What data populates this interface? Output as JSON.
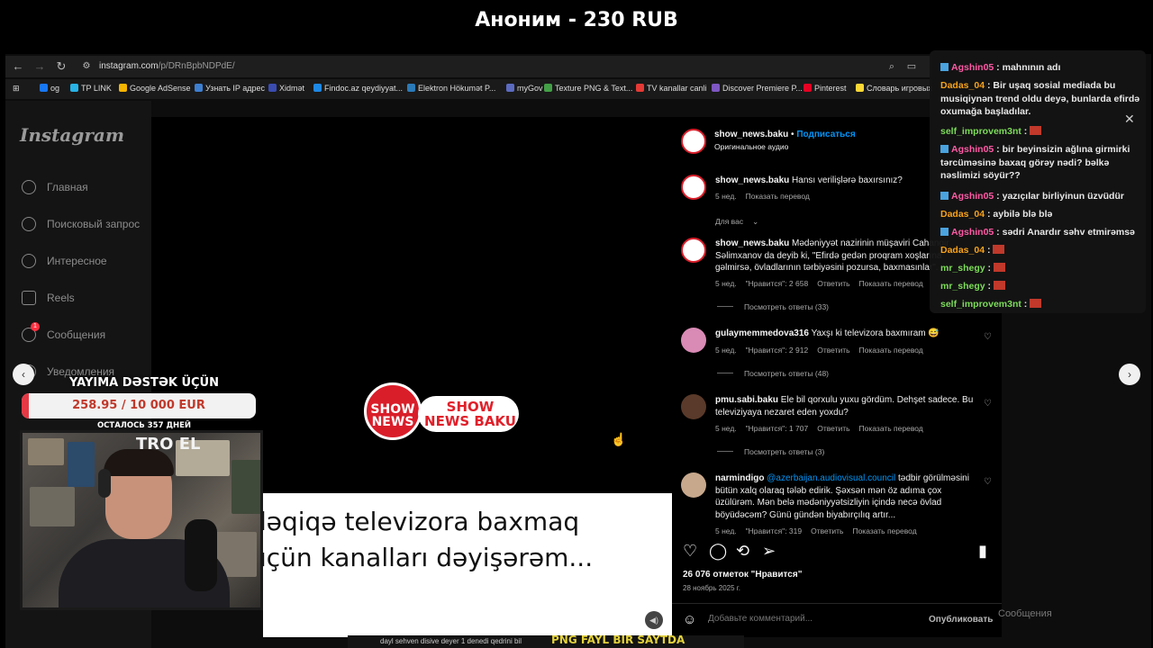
{
  "stream": {
    "donor_banner": "Аноним - 230 RUB",
    "donate": {
      "title": "YAYIMA DƏSTƏK ÜÇÜN",
      "amount": "258.95 / 10 000 EUR",
      "progress_fraction": 0.0259,
      "days_left": "ОСТАЛОСЬ 357 ДНЕЙ"
    },
    "webcam_poster": "TRO EL"
  },
  "browser": {
    "url_domain": "instagram.com",
    "url_path": "/p/DRnBpbNDPdE/",
    "bookmarks": [
      {
        "label": "og",
        "color": "#1877f2"
      },
      {
        "label": "TP LINK",
        "color": "#27b3e6"
      },
      {
        "label": "Google AdSense",
        "color": "#f4b400"
      },
      {
        "label": "Узнать IP адрес",
        "color": "#3d7fd1"
      },
      {
        "label": "Xidmət",
        "color": "#3a4cb0"
      },
      {
        "label": "Findoc.az qeydiyyat...",
        "color": "#1e88e5"
      },
      {
        "label": "Elektron Hökumət P...",
        "color": "#2a7ab8"
      },
      {
        "label": "myGov",
        "color": "#5c6bc0"
      },
      {
        "label": "Texture PNG & Text...",
        "color": "#43a047"
      },
      {
        "label": "TV kanallar canli",
        "color": "#e53935"
      },
      {
        "label": "Discover Premiere P...",
        "color": "#7e57c2"
      },
      {
        "label": "Pinterest",
        "color": "#e60023"
      },
      {
        "label": "Словарь игровых",
        "color": "#fdd835"
      }
    ]
  },
  "instagram": {
    "logo": "Instagram",
    "nav": [
      "Главная",
      "Поисковый запрос",
      "Интересное",
      "Reels",
      "Сообщения",
      "Уведомления"
    ],
    "messages_badge": "1",
    "video": {
      "logo_show": "SHOW NEWS",
      "logo_brand": "SHOW NEWS BAKU",
      "caption_line1": "dəqiqə televizora baxmaq",
      "caption_line2": "üçün kanalları dəyişərəm..."
    },
    "post": {
      "author": "show_news.baku",
      "follow": "Подписаться",
      "audio": "Оригинальное аудио",
      "caption": "Hansı verilişlərə baxırsınız?",
      "caption_age": "5 нед.",
      "translate": "Показать перевод",
      "for_you": "Для вас",
      "comments": [
        {
          "user": "show_news.baku",
          "text": "Mədəniyyət nazirinin müşaviri Cahangir Səlimxanov da deyib ki, \"Efirdə gedən proqram xoşlarına gəlmirsə, övladlarının tərbiyəsini pozursa, baxmasınlar\".",
          "age": "5 нед.",
          "likes": "\"Нравится\": 2 658",
          "reply": "Ответить",
          "translate": "Показать перевод",
          "replies": "Посмотреть ответы (33)"
        },
        {
          "user": "gulaymemmedova316",
          "text": "Yaxşı ki televizora baxmıram 😅",
          "age": "5 нед.",
          "likes": "\"Нравится\": 2 912",
          "reply": "Ответить",
          "translate": "Показать перевод",
          "replies": "Посмотреть ответы (48)"
        },
        {
          "user": "pmu.sabi.baku",
          "text": "Ele bil qorxulu yuxu gördüm. Dehşet sadece. Bu televiziyaya nezaret eden yoxdu?",
          "age": "5 нед.",
          "likes": "\"Нравится\": 1 707",
          "reply": "Ответить",
          "translate": "Показать перевод",
          "replies": "Посмотреть ответы (3)"
        },
        {
          "user": "narmindigo",
          "mention": "@azerbaijan.audiovisual.council",
          "text": "tədbir görülməsini bütün xalq olaraq tələb edirik. Şəxsən mən öz adıma çox üzülürəm. Mən belə mədəniyyətsizliyin içində necə övlad böyüdəcəm? Günü gündən biyabırçılıq artır...",
          "age": "5 нед.",
          "likes": "\"Нравится\": 319",
          "reply": "Ответить",
          "translate": "Показать перевод"
        }
      ],
      "likes_total": "26 076 отметок \"Нравится\"",
      "date": "28 ноябрь 2025 г.",
      "comment_placeholder": "Добавьте комментарий...",
      "publish": "Опубликовать"
    },
    "bg_messages": "Сообщения"
  },
  "chat": [
    {
      "user": "Agshin05",
      "color": "#ff5aa5",
      "text": "mahnının adı",
      "icon": true
    },
    {
      "user": "Dadas_04",
      "color": "#f7a21b",
      "text": "Bir uşaq sosial mediada bu musiqiynən trend oldu deyə, bunlarda efirdə oxumağa başladılar.",
      "icon": false
    },
    {
      "user": "self_improvem3nt",
      "color": "#7ddc5a",
      "text": "",
      "icon": false,
      "emote": true
    },
    {
      "user": "Agshin05",
      "color": "#ff5aa5",
      "text": "bir beyinsizin ağlına girmirki tərcüməsinə baxaq görəy nədi? bəlkə nəslimizi söyür??",
      "icon": true
    },
    {
      "user": "Agshin05",
      "color": "#ff5aa5",
      "text": "yazıçılar birliyinun üzvüdür",
      "icon": true
    },
    {
      "user": "Dadas_04",
      "color": "#f7a21b",
      "text": "aybilə blə blə",
      "icon": false
    },
    {
      "user": "Agshin05",
      "color": "#ff5aa5",
      "text": "sədri Anardır səhv etmirəmsə",
      "icon": true
    },
    {
      "user": "Dadas_04",
      "color": "#f7a21b",
      "text": "",
      "icon": false,
      "emote": true
    },
    {
      "user": "mr_shegy",
      "color": "#7ddc5a",
      "text": "",
      "icon": false,
      "emote": true
    },
    {
      "user": "mr_shegy",
      "color": "#7ddc5a",
      "text": "",
      "icon": false,
      "emote": true
    },
    {
      "user": "self_improvem3nt",
      "color": "#7ddc5a",
      "text": "",
      "icon": false,
      "emote": true
    }
  ],
  "bottom_overlay": {
    "left_text": "dayl sehven disive deyer 1 denedi qedrini bil",
    "right_text": "PNG FAYL BIR SAYTDA"
  },
  "colors": {
    "accent_blue": "#0095f6",
    "donate_red": "#e53945",
    "brand_red": "#d91e2a"
  }
}
